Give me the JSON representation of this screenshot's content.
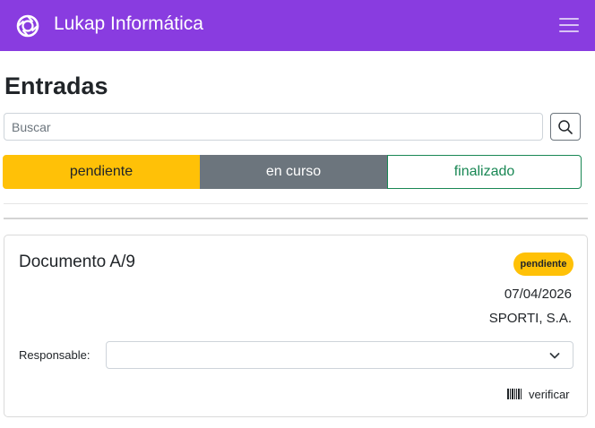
{
  "navbar": {
    "brand": "Lukap Informática",
    "logo_icon": "aperture-logo-icon",
    "menu_icon": "hamburger-icon",
    "background": "#893ce0"
  },
  "page": {
    "title": "Entradas"
  },
  "search": {
    "placeholder": "Buscar",
    "value": "",
    "button_icon": "search-icon"
  },
  "status_tabs": [
    {
      "label": "pendiente",
      "color": "#ffc107",
      "state": "selected"
    },
    {
      "label": "en curso",
      "color": "#6c757d",
      "state": "selected"
    },
    {
      "label": "finalizado",
      "color": "#198754",
      "state": "outline"
    }
  ],
  "document": {
    "title": "Documento A/9",
    "status_badge": "pendiente",
    "date": "07/04/2026",
    "client": "SPORTI, S.A.",
    "responsible_label": "Responsable:",
    "responsible_value": "",
    "verify_label": "verificar",
    "verify_icon": "barcode-icon"
  }
}
